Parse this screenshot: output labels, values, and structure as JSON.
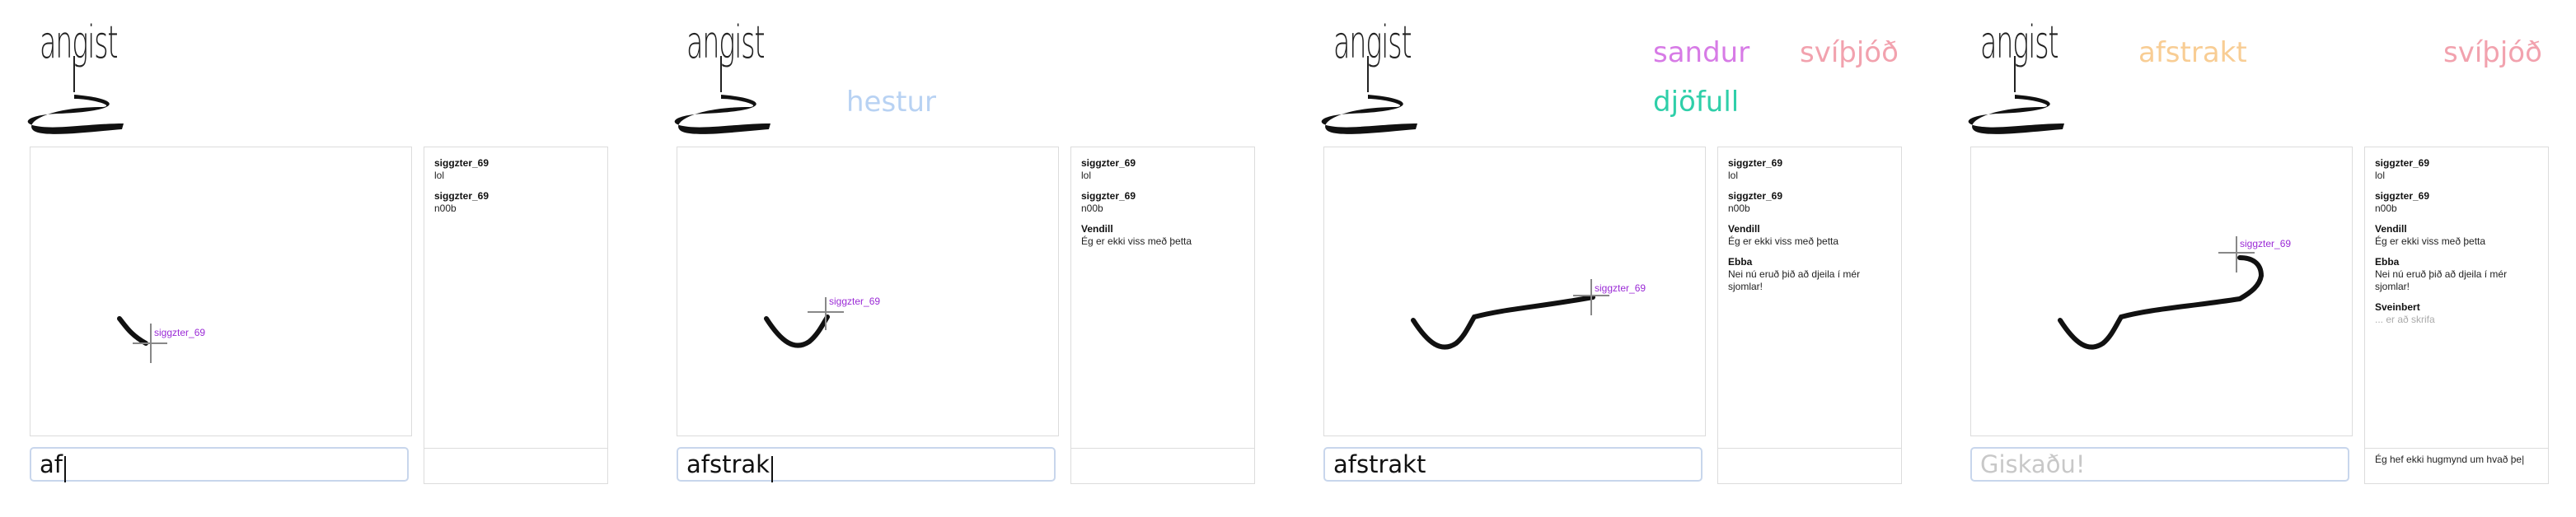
{
  "app": {
    "logo_text": "angist"
  },
  "colors": {
    "cursor_label": "#9b2bd6",
    "input_border": "#c8d6ec"
  },
  "panels": [
    {
      "words": [],
      "cursor_user": "siggzter_69",
      "messages": [
        {
          "author": "siggzter_69",
          "text": "lol"
        },
        {
          "author": "siggzter_69",
          "text": "n00b"
        }
      ],
      "guess_value": "af",
      "guess_placeholder": "",
      "chat_input": ""
    },
    {
      "words": [
        {
          "text": "hestur",
          "color": "#b8d2f3"
        }
      ],
      "cursor_user": "siggzter_69",
      "messages": [
        {
          "author": "siggzter_69",
          "text": "lol"
        },
        {
          "author": "siggzter_69",
          "text": "n00b"
        },
        {
          "author": "Vendill",
          "text": "Ég er ekki viss með þetta"
        }
      ],
      "guess_value": "afstrak",
      "guess_placeholder": "",
      "chat_input": ""
    },
    {
      "words": [
        {
          "text": "sandur",
          "color": "#d77be6"
        },
        {
          "text": "svíþjóð",
          "color": "#f2a2ae"
        },
        {
          "text": "djöfull",
          "color": "#2fcfa9"
        }
      ],
      "cursor_user": "siggzter_69",
      "messages": [
        {
          "author": "siggzter_69",
          "text": "lol"
        },
        {
          "author": "siggzter_69",
          "text": "n00b"
        },
        {
          "author": "Vendill",
          "text": "Ég er ekki viss með þetta"
        },
        {
          "author": "Ebba",
          "text": "Nei nú eruð þið að djeila í mér sjomlar!"
        }
      ],
      "guess_value": "afstrakt",
      "guess_placeholder": "",
      "chat_input": ""
    },
    {
      "words": [
        {
          "text": "afstrakt",
          "color": "#f8cd94"
        },
        {
          "text": "svíþjóð",
          "color": "#f2a2ae"
        }
      ],
      "cursor_user": "siggzter_69",
      "messages": [
        {
          "author": "siggzter_69",
          "text": "lol"
        },
        {
          "author": "siggzter_69",
          "text": "n00b"
        },
        {
          "author": "Vendill",
          "text": "Ég er ekki viss með þetta"
        },
        {
          "author": "Ebba",
          "text": "Nei nú eruð þið að djeila í mér sjomlar!"
        },
        {
          "author": "Sveinbert",
          "text": "... er að skrifa",
          "pending": true
        }
      ],
      "guess_value": "",
      "guess_placeholder": "Giskaðu!",
      "chat_input": "Ég hef ekki hugmynd um hvað þe|"
    }
  ]
}
